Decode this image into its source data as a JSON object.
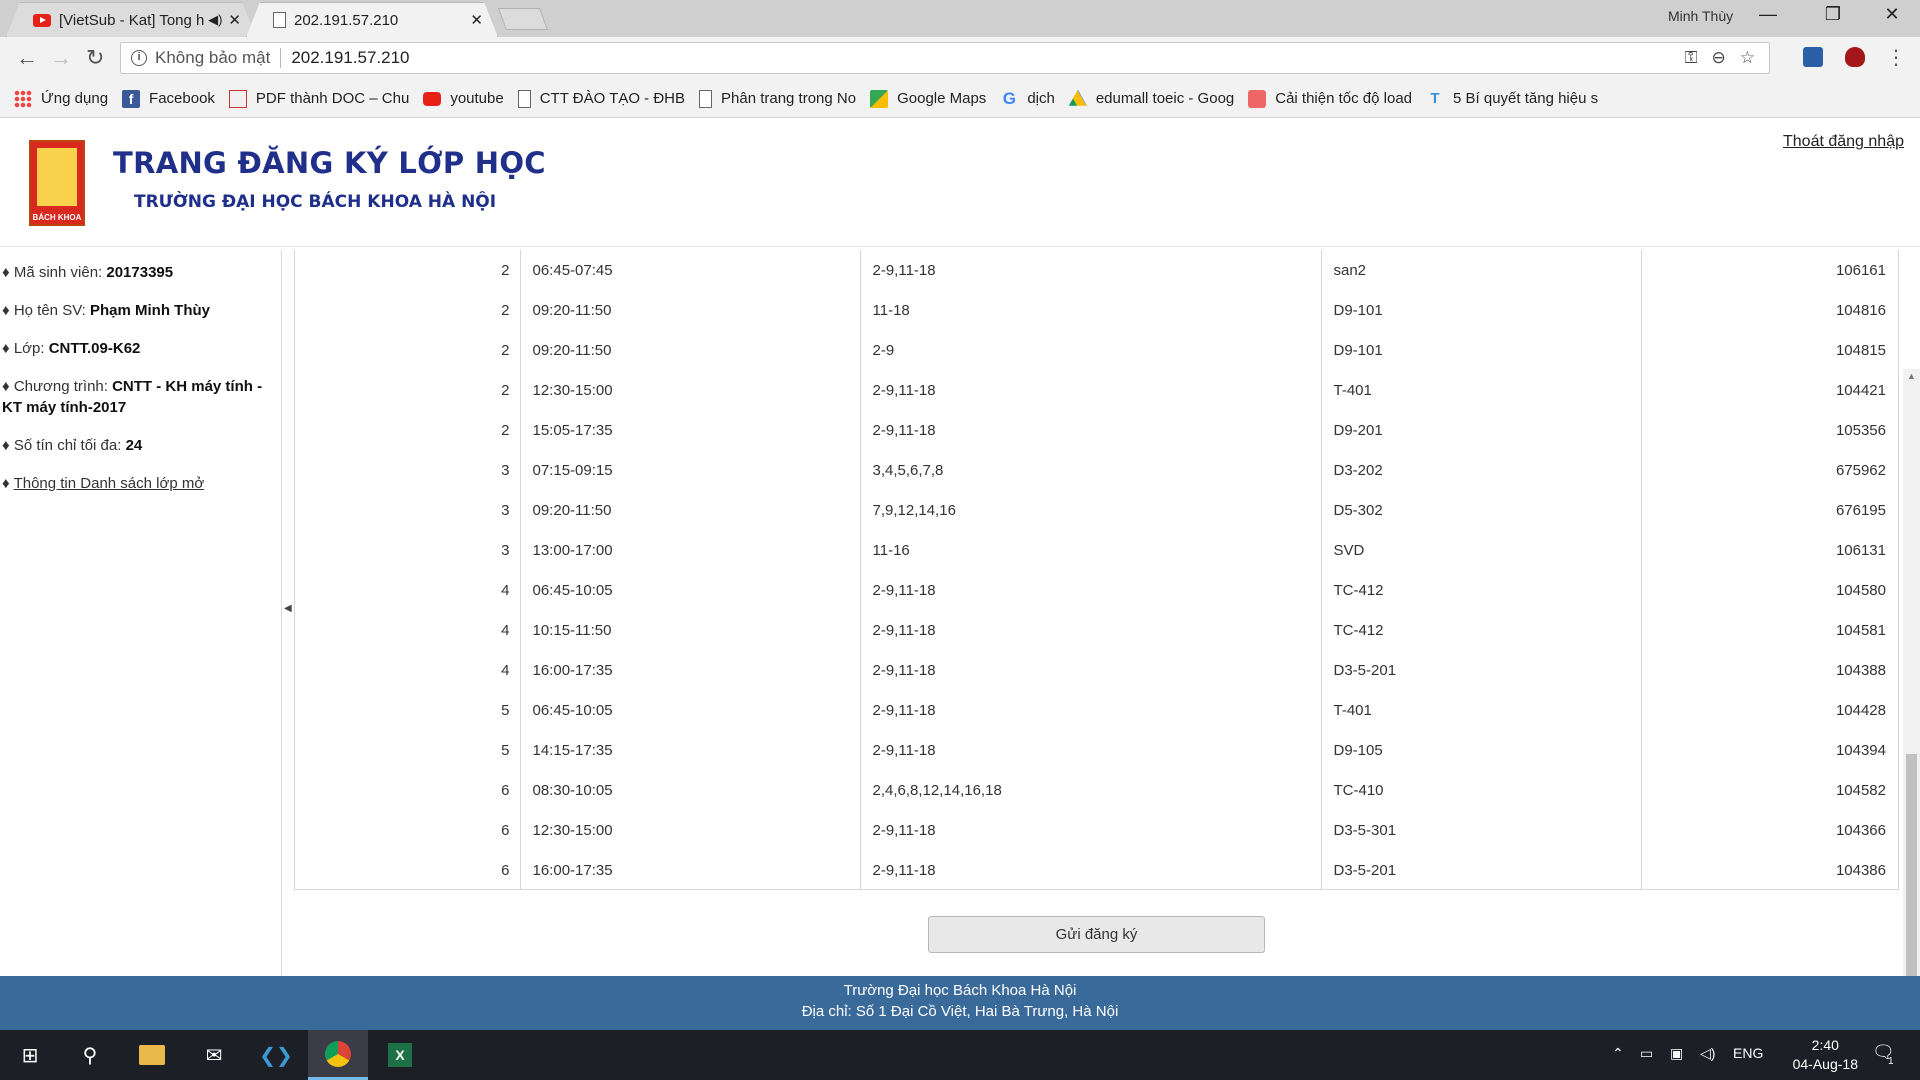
{
  "browser": {
    "tabs": [
      {
        "title": "[VietSub - Kat] Tong h",
        "active": false,
        "has_audio": true
      },
      {
        "title": "202.191.57.210",
        "active": true
      }
    ],
    "profile_name": "Minh Thùy",
    "address": {
      "security_label": "Không bảo mật",
      "url": "202.191.57.210"
    },
    "bookmarks": [
      {
        "label": "Ứng dụng",
        "icon": "apps-icon"
      },
      {
        "label": "Facebook",
        "icon": "facebook-icon"
      },
      {
        "label": "PDF thành DOC – Chu",
        "icon": "pdf-icon"
      },
      {
        "label": "youtube",
        "icon": "youtube-icon"
      },
      {
        "label": "CTT ĐÀO TẠO - ĐHB",
        "icon": "page-icon"
      },
      {
        "label": "Phân trang trong No",
        "icon": "page-icon"
      },
      {
        "label": "Google Maps",
        "icon": "maps-icon"
      },
      {
        "label": "dịch",
        "icon": "google-icon"
      },
      {
        "label": "edumall toeic - Goog",
        "icon": "drive-icon"
      },
      {
        "label": "Cải thiện tốc độ load",
        "icon": "site-icon"
      },
      {
        "label": "5 Bí quyết tăng hiệu s",
        "icon": "site-icon"
      }
    ]
  },
  "header": {
    "title": "TRANG ĐĂNG KÝ LỚP HỌC",
    "subtitle": "TRƯỜNG ĐẠI HỌC BÁCH KHOA HÀ NỘI",
    "logout": "Thoát đăng nhập",
    "logo_text": "BÁCH KHOA"
  },
  "sidebar": {
    "student_id_label": "Mã sinh viên: ",
    "student_id": "20173395",
    "name_label": "Họ tên SV: ",
    "name": "Phạm Minh Thùy",
    "class_label": "Lớp: ",
    "class": "CNTT.09-K62",
    "program_label": "Chương trình: ",
    "program": "CNTT - KH máy tính - KT máy tính-2017",
    "max_credits_label": "Số tín chỉ tối đa: ",
    "max_credits": "24",
    "open_classes_link": "Thông tin Danh sách lớp mở"
  },
  "schedule": {
    "rows": [
      {
        "day": "2",
        "time": "06:45-07:45",
        "weeks": "2-9,11-18",
        "room": "san2",
        "code": "106161"
      },
      {
        "day": "2",
        "time": "09:20-11:50",
        "weeks": "11-18",
        "room": "D9-101",
        "code": "104816"
      },
      {
        "day": "2",
        "time": "09:20-11:50",
        "weeks": "2-9",
        "room": "D9-101",
        "code": "104815"
      },
      {
        "day": "2",
        "time": "12:30-15:00",
        "weeks": "2-9,11-18",
        "room": "T-401",
        "code": "104421"
      },
      {
        "day": "2",
        "time": "15:05-17:35",
        "weeks": "2-9,11-18",
        "room": "D9-201",
        "code": "105356"
      },
      {
        "day": "3",
        "time": "07:15-09:15",
        "weeks": "3,4,5,6,7,8",
        "room": "D3-202",
        "code": "675962"
      },
      {
        "day": "3",
        "time": "09:20-11:50",
        "weeks": "7,9,12,14,16",
        "room": "D5-302",
        "code": "676195"
      },
      {
        "day": "3",
        "time": "13:00-17:00",
        "weeks": "11-16",
        "room": "SVD",
        "code": "106131"
      },
      {
        "day": "4",
        "time": "06:45-10:05",
        "weeks": "2-9,11-18",
        "room": "TC-412",
        "code": "104580"
      },
      {
        "day": "4",
        "time": "10:15-11:50",
        "weeks": "2-9,11-18",
        "room": "TC-412",
        "code": "104581"
      },
      {
        "day": "4",
        "time": "16:00-17:35",
        "weeks": "2-9,11-18",
        "room": "D3-5-201",
        "code": "104388"
      },
      {
        "day": "5",
        "time": "06:45-10:05",
        "weeks": "2-9,11-18",
        "room": "T-401",
        "code": "104428"
      },
      {
        "day": "5",
        "time": "14:15-17:35",
        "weeks": "2-9,11-18",
        "room": "D9-105",
        "code": "104394"
      },
      {
        "day": "6",
        "time": "08:30-10:05",
        "weeks": "2,4,6,8,12,14,16,18",
        "room": "TC-410",
        "code": "104582"
      },
      {
        "day": "6",
        "time": "12:30-15:00",
        "weeks": "2-9,11-18",
        "room": "D3-5-301",
        "code": "104366"
      },
      {
        "day": "6",
        "time": "16:00-17:35",
        "weeks": "2-9,11-18",
        "room": "D3-5-201",
        "code": "104386"
      }
    ],
    "submit_label": "Gửi đăng ký"
  },
  "footer": {
    "line1": "Trường Đại học Bách Khoa Hà Nội",
    "line2": "Địa chỉ: Số 1 Đại Cồ Việt, Hai Bà Trưng, Hà Nội"
  },
  "taskbar": {
    "language": "ENG",
    "time": "2:40",
    "date": "04-Aug-18",
    "notification_count": "1"
  }
}
